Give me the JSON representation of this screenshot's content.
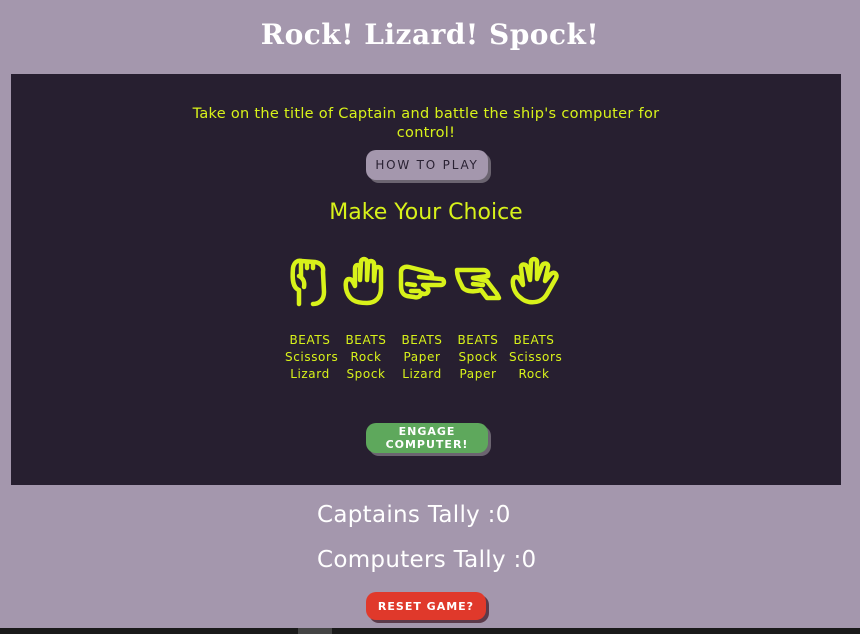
{
  "header": {
    "title": "Rock! Lizard! Spock!"
  },
  "intro": {
    "text": "Take on the title of Captain and battle the ship's computer for control!"
  },
  "buttons": {
    "how_to_play": "HOW TO PLAY",
    "engage_line1": "ENGAGE",
    "engage_line2": "COMPUTER!",
    "reset": "RESET GAME?"
  },
  "choice": {
    "heading": "Make Your Choice",
    "options": [
      {
        "name": "rock",
        "icon": "hand-rock-icon",
        "beats_label": "BEATS",
        "beats": [
          "Scissors",
          "Lizard"
        ]
      },
      {
        "name": "paper",
        "icon": "hand-paper-icon",
        "beats_label": "BEATS",
        "beats": [
          "Rock",
          "Spock"
        ]
      },
      {
        "name": "scissors",
        "icon": "hand-scissors-icon",
        "beats_label": "BEATS",
        "beats": [
          "Paper",
          "Lizard"
        ]
      },
      {
        "name": "lizard",
        "icon": "hand-lizard-icon",
        "beats_label": "BEATS",
        "beats": [
          "Spock",
          "Paper"
        ]
      },
      {
        "name": "spock",
        "icon": "hand-spock-icon",
        "beats_label": "BEATS",
        "beats": [
          "Scissors",
          "Rock"
        ]
      }
    ]
  },
  "tally": {
    "captain": "Captains Tally :0",
    "computer": "Computers Tally :0"
  },
  "colors": {
    "background": "#a497ad",
    "panel": "#271f30",
    "accent": "#d8f21a",
    "engage": "#5ea85c",
    "reset": "#e0392b"
  }
}
